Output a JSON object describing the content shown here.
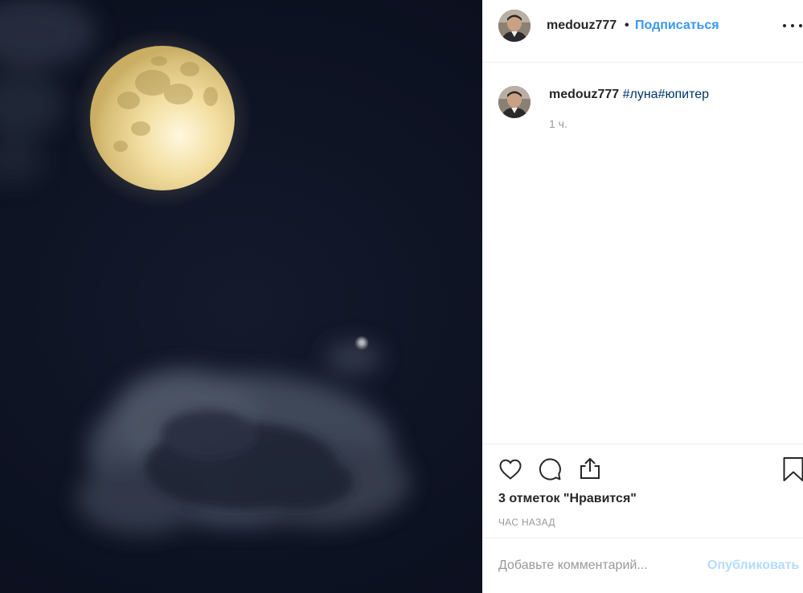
{
  "post": {
    "image_alt": "",
    "author": "medouz777",
    "follow_separator": "•",
    "follow_label": "Подписаться",
    "caption_user": "medouz777",
    "caption_tags": "#луна#юпитер",
    "caption_age": "1 ч.",
    "likes_text": "3 отметок \"Нравится\"",
    "posted_time": "ЧАС НАЗАД"
  },
  "comment_box": {
    "placeholder": "Добавьте комментарий...",
    "publish_label": "Опубликовать"
  },
  "icons": {
    "more": "more-options-icon",
    "like": "heart-icon",
    "comment": "speech-bubble-icon",
    "share": "share-icon",
    "save": "bookmark-icon"
  },
  "colors": {
    "link_blue": "#3897f0",
    "hashtag": "#003569",
    "muted": "#999999",
    "publish_disabled": "#b3dbff",
    "border": "#efefef"
  }
}
